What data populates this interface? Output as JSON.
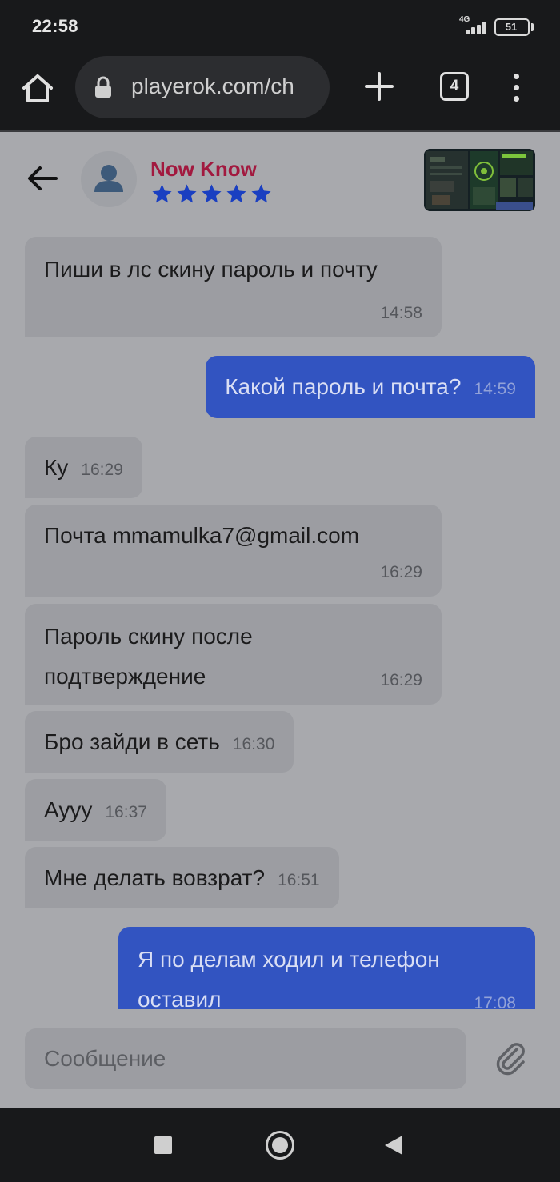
{
  "status_bar": {
    "time": "22:58",
    "network": "4G",
    "battery": "51"
  },
  "browser": {
    "url": "playerok.com/ch",
    "tab_count": "4",
    "icons": [
      "home-icon",
      "lock-icon",
      "plus-icon",
      "tabs-icon",
      "more-vert-icon"
    ]
  },
  "chat_header": {
    "user_name": "Now Know",
    "rating_stars": 5,
    "colors": {
      "name": "#a2193f",
      "stars": "#1a3fc1"
    }
  },
  "messages": [
    {
      "direction": "in",
      "text": "Пиши в лс скину пароль и почту",
      "time": "14:58"
    },
    {
      "direction": "out",
      "text": "Какой пароль и почта?",
      "time": "14:59"
    },
    {
      "direction": "in",
      "text": "Ку",
      "time": "16:29"
    },
    {
      "direction": "in",
      "text": "Почта mmamulka7@gmail.com",
      "time": "16:29"
    },
    {
      "direction": "in",
      "text": "Пароль скину после подтверждение",
      "time": "16:29"
    },
    {
      "direction": "in",
      "text": "Бро зайди в сеть",
      "time": "16:30"
    },
    {
      "direction": "in",
      "text": "Аууу",
      "time": "16:37"
    },
    {
      "direction": "in",
      "text": "Мне делать вовзрат?",
      "time": "16:51"
    },
    {
      "direction": "out",
      "text": "Я по делам ходил и телефон оставил",
      "time": "17:08"
    }
  ],
  "composer": {
    "placeholder": "Сообщение"
  },
  "colors": {
    "background": "#a8a9ad",
    "incoming_bubble": "#9c9da2",
    "outgoing_bubble": "#3254c1",
    "system_bars": "#18191b"
  }
}
